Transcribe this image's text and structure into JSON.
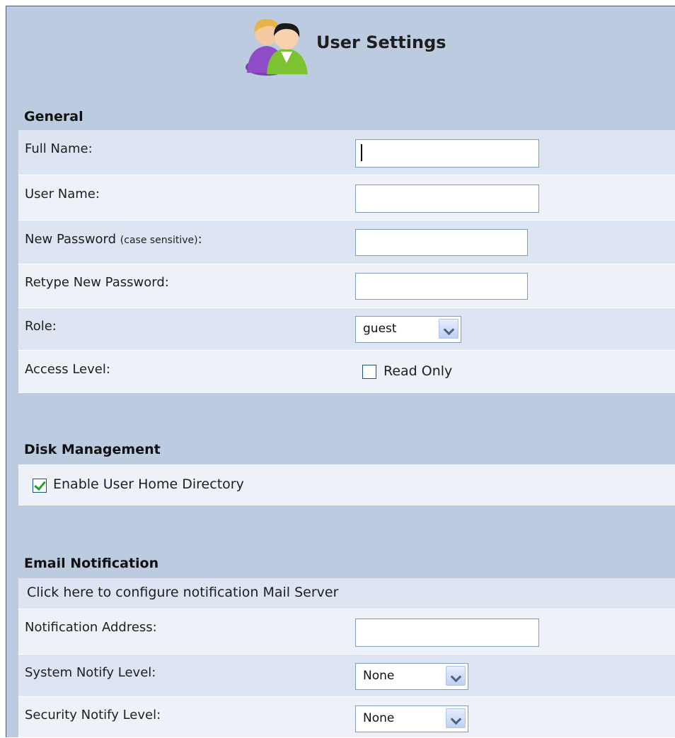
{
  "header": {
    "title": "User Settings",
    "icon": "users-icon"
  },
  "general": {
    "title": "General",
    "full_name": {
      "label": "Full Name:",
      "value": ""
    },
    "user_name": {
      "label": "User Name:",
      "value": ""
    },
    "new_password": {
      "label": "New Password ",
      "hint": "(case sensitive)",
      "suffix": ":",
      "value": ""
    },
    "retype_password": {
      "label": "Retype New Password:",
      "value": ""
    },
    "role": {
      "label": "Role:",
      "value": "guest"
    },
    "access_level": {
      "label": "Access Level:",
      "checkbox_label": "Read Only",
      "checked": false
    }
  },
  "disk": {
    "title": "Disk Management",
    "home_dir": {
      "label": "Enable User Home Directory",
      "checked": true
    }
  },
  "email": {
    "title": "Email Notification",
    "config_link": "Click here to configure notification Mail Server",
    "address": {
      "label": "Notification Address:",
      "value": ""
    },
    "system_level": {
      "label": "System Notify Level:",
      "value": "None"
    },
    "security_level": {
      "label": "Security Notify Level:",
      "value": "None"
    }
  },
  "colors": {
    "background": "#bccbdf",
    "row_alt": "#dee5f2",
    "row_plain": "#eef2f8",
    "checkmark": "#21a121"
  }
}
